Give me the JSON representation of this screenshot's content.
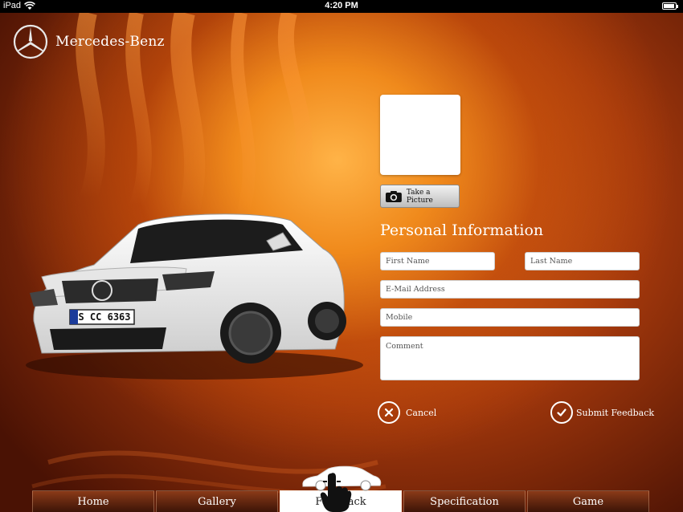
{
  "status_bar": {
    "device": "iPad",
    "time": "4:20 PM"
  },
  "brand": {
    "name": "Mercedes-Benz",
    "logo_icon": "mercedes-star-icon"
  },
  "car": {
    "license_plate": "S CC 6363"
  },
  "photo": {
    "take_picture_label": "Take a Picture",
    "camera_icon": "camera-icon"
  },
  "form": {
    "section_title": "Personal Information",
    "first_name": {
      "placeholder": "First Name",
      "value": ""
    },
    "last_name": {
      "placeholder": "Last Name",
      "value": ""
    },
    "email": {
      "placeholder": "E-Mail Address",
      "value": ""
    },
    "mobile": {
      "placeholder": "Mobile",
      "value": ""
    },
    "comment": {
      "placeholder": "Comment",
      "value": ""
    }
  },
  "actions": {
    "cancel_label": "Cancel",
    "submit_label": "Submit Feedback"
  },
  "tabs": [
    {
      "label": "Home"
    },
    {
      "label": "Gallery"
    },
    {
      "label": "Feedback",
      "active": true
    },
    {
      "label": "Specification"
    },
    {
      "label": "Game"
    }
  ],
  "colors": {
    "accent_orange": "#f08a1c",
    "deep_red": "#4a1204",
    "white": "#ffffff"
  }
}
